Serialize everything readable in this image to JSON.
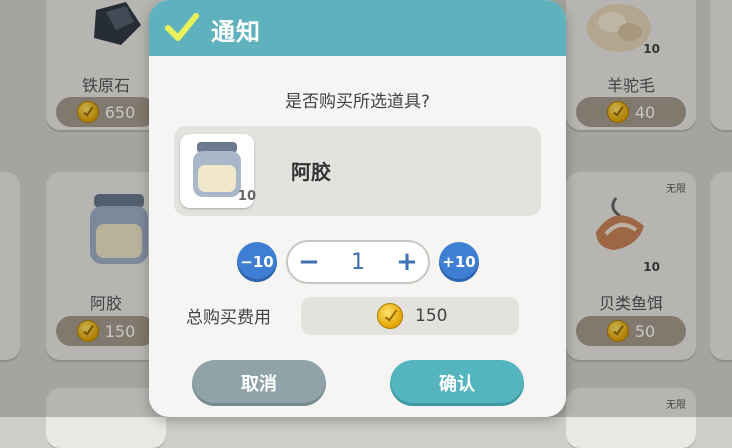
{
  "background_cards": [
    {
      "name": "铁原石",
      "price": "650",
      "badge": "",
      "unlimited": ""
    },
    {
      "name": "羊驼毛",
      "price": "40",
      "badge": "10",
      "unlimited": ""
    },
    {
      "name": "阿胶",
      "price": "150",
      "badge": "",
      "unlimited": ""
    },
    {
      "name": "贝类鱼饵",
      "price": "50",
      "badge": "10",
      "unlimited": "无限"
    },
    {
      "name": "",
      "price": "",
      "badge": "",
      "unlimited": "无限"
    }
  ],
  "dialog": {
    "title": "通知",
    "question": "是否购买所选道具?",
    "item": {
      "name": "阿胶",
      "count": "10"
    },
    "step_minus10": "−10",
    "step_plus10": "+10",
    "quantity": "1",
    "cost_label": "总购买费用",
    "cost_value": "150",
    "cancel_label": "取消",
    "confirm_label": "确认"
  },
  "colors": {
    "header": "#5fb2bd",
    "confirm": "#55b5bf",
    "cancel": "#8fa3a8",
    "step": "#3f7fd3"
  },
  "icons": [
    "checkmark-icon",
    "jar-icon",
    "coin-icon",
    "minus-icon",
    "plus-icon"
  ]
}
